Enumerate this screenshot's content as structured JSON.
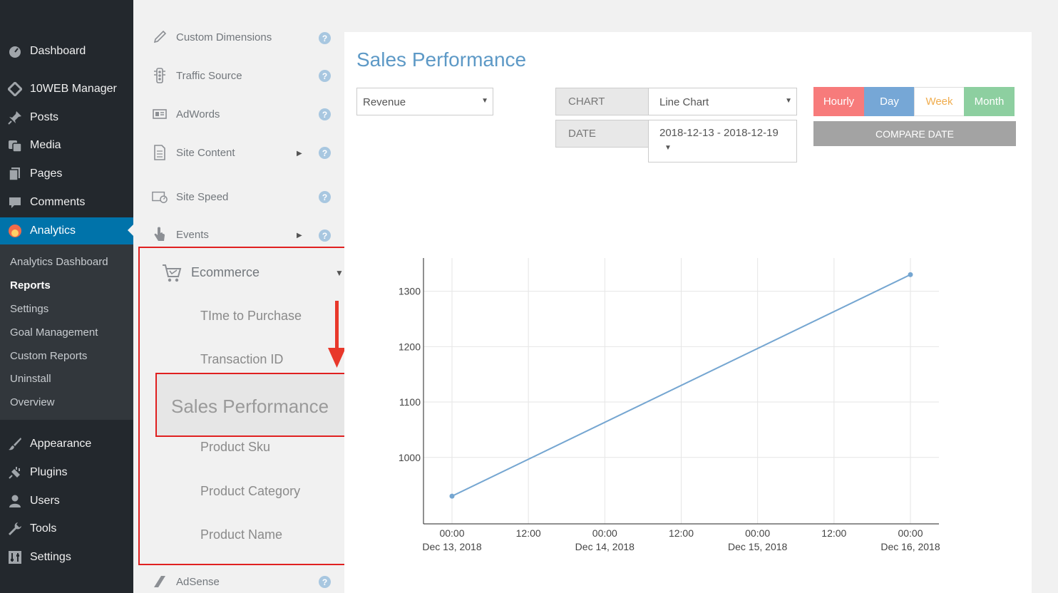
{
  "wp_menu": {
    "items": [
      {
        "label": "Dashboard",
        "icon": "dashboard-icon"
      },
      {
        "label": "10WEB Manager",
        "icon": "diamond-icon"
      },
      {
        "label": "Posts",
        "icon": "pin-icon"
      },
      {
        "label": "Media",
        "icon": "media-icon"
      },
      {
        "label": "Pages",
        "icon": "pages-icon"
      },
      {
        "label": "Comments",
        "icon": "comment-icon"
      },
      {
        "label": "Analytics",
        "icon": "analytics-icon"
      },
      {
        "label": "Appearance",
        "icon": "brush-icon"
      },
      {
        "label": "Plugins",
        "icon": "plug-icon"
      },
      {
        "label": "Users",
        "icon": "user-icon"
      },
      {
        "label": "Tools",
        "icon": "wrench-icon"
      },
      {
        "label": "Settings",
        "icon": "settings-icon"
      }
    ],
    "submenu": [
      "Analytics Dashboard",
      "Reports",
      "Settings",
      "Goal Management",
      "Custom Reports",
      "Uninstall",
      "Overview"
    ]
  },
  "reports_menu": {
    "items": [
      {
        "label": "Custom Dimensions",
        "icon": "pencil-icon"
      },
      {
        "label": "Traffic Source",
        "icon": "traffic-light-icon"
      },
      {
        "label": "AdWords",
        "icon": "adwords-icon"
      },
      {
        "label": "Site Content",
        "icon": "document-icon"
      },
      {
        "label": "Site Speed",
        "icon": "speed-icon"
      },
      {
        "label": "Events",
        "icon": "hand-pointer-icon"
      }
    ],
    "help_glyph": "?",
    "expand_glyph": "▶",
    "ecommerce": {
      "label": "Ecommerce",
      "icon": "cart-icon",
      "collapse_glyph": "▼",
      "subitems": [
        "TIme to Purchase",
        "Transaction ID",
        "Sales Performance",
        "Product Sku",
        "Product Category",
        "Product Name"
      ]
    },
    "adsense": {
      "label": "AdSense",
      "icon": "adsense-icon"
    }
  },
  "main": {
    "title": "Sales Performance",
    "metric_select": "Revenue",
    "chart_label": "CHART",
    "chart_type": "Line Chart",
    "date_label": "DATE",
    "date_range": "2018-12-13 - 2018-12-19",
    "caret": "▼",
    "periods": [
      {
        "label": "Hourly",
        "color": "#f77b7b"
      },
      {
        "label": "Day",
        "color": "#76a7d6"
      },
      {
        "label": "Week",
        "color": "#ffffff",
        "text_color": "#f0ad4e"
      },
      {
        "label": "Month",
        "color": "#8dcfa0"
      }
    ],
    "compare_date": "COMPARE DATE"
  },
  "chart_data": {
    "type": "line",
    "series": [
      {
        "x": [
          "2018-12-13 00:00",
          "2018-12-16 00:00"
        ],
        "y": [
          930,
          1330
        ]
      }
    ],
    "color": "#75a6d1",
    "x_ticks": [
      {
        "time": "00:00",
        "date": "Dec 13, 2018"
      },
      {
        "time": "12:00",
        "date": ""
      },
      {
        "time": "00:00",
        "date": "Dec 14, 2018"
      },
      {
        "time": "12:00",
        "date": ""
      },
      {
        "time": "00:00",
        "date": "Dec 15, 2018"
      },
      {
        "time": "12:00",
        "date": ""
      },
      {
        "time": "00:00",
        "date": "Dec 16, 2018"
      }
    ],
    "y_ticks": [
      1000,
      1100,
      1200,
      1300
    ],
    "grid": true
  }
}
